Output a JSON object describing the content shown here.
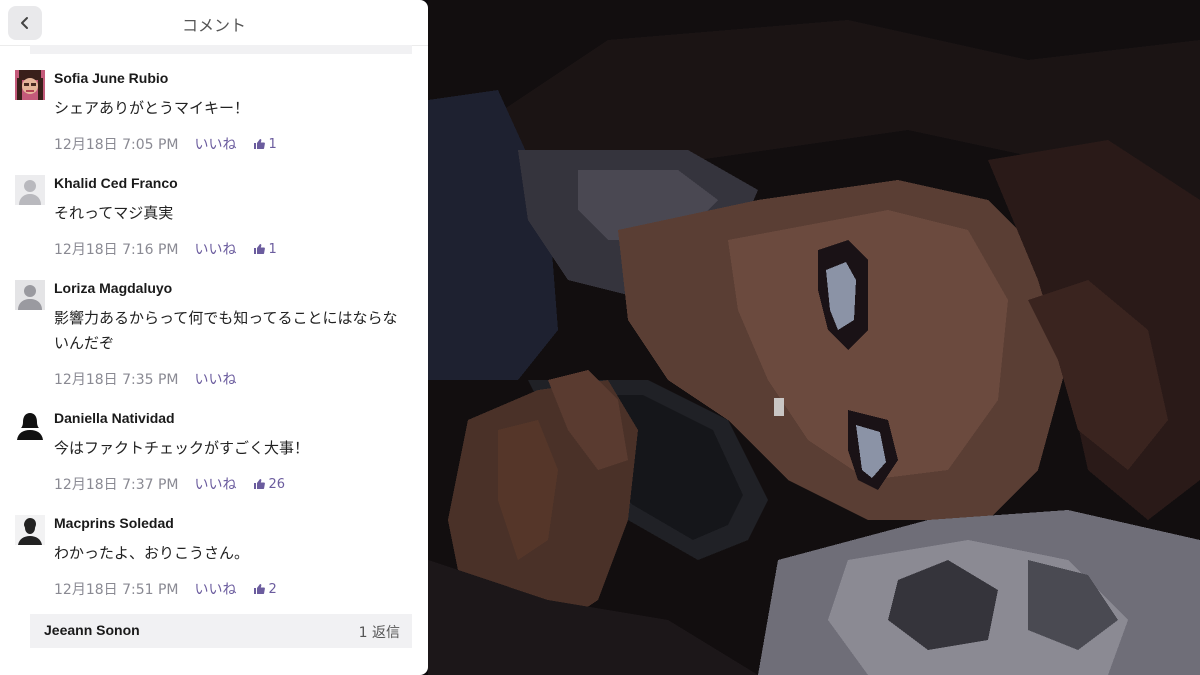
{
  "panel": {
    "title": "コメント",
    "back_icon": "chevron-left-icon"
  },
  "comments": [
    {
      "name": "Sofia June Rubio",
      "text": "シェアありがとうマイキー！",
      "timestamp": "12月18日 7:05 PM",
      "like_label": "いいね",
      "like_count": "1",
      "avatar": "photo-avatar"
    },
    {
      "name": "Khalid Ced Franco",
      "text": "それってマジ真実",
      "timestamp": "12月18日 7:16 PM",
      "like_label": "いいね",
      "like_count": "1",
      "avatar": "default-person-avatar"
    },
    {
      "name": "Loriza Magdaluyo",
      "text": "影響力あるからって何でも知ってることにはならないんだぞ",
      "timestamp": "12月18日 7:35 PM",
      "like_label": "いいね",
      "like_count": null,
      "avatar": "default-person-avatar"
    },
    {
      "name": "Daniella Natividad",
      "text": "今はファクトチェックがすごく大事！",
      "timestamp": "12月18日 7:37 PM",
      "like_label": "いいね",
      "like_count": "26",
      "avatar": "silhouette-avatar"
    },
    {
      "name": "Macprins Soledad",
      "text": "わかったよ、おりこうさん。",
      "timestamp": "12月18日 7:51 PM",
      "like_label": "いいね",
      "like_count": "2",
      "avatar": "silhouette-avatar"
    }
  ],
  "reply": {
    "name": "Jeeann Sonon",
    "count": "1 返信"
  },
  "colors": {
    "accent": "#6b5c9e",
    "meta": "#8a8a93",
    "panel_bg": "#ffffff",
    "strip_bg": "#f1f1f3"
  }
}
